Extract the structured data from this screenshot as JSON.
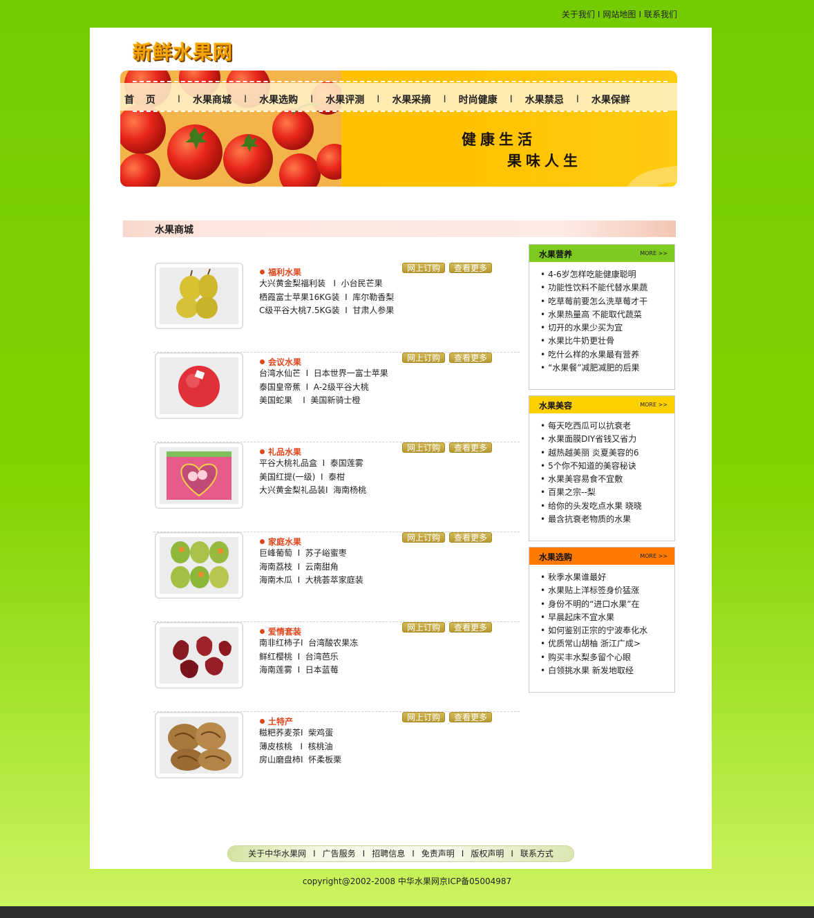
{
  "top_links": [
    "关于我们",
    "网站地图",
    "联系我们"
  ],
  "logo_text": "新鲜水果网",
  "nav": [
    "首 页",
    "水果商城",
    "水果选购",
    "水果评测",
    "水果采摘",
    "时尚健康",
    "水果禁忌",
    "水果保鲜"
  ],
  "slogan": {
    "line1": "健康生活",
    "line2": "果味人生"
  },
  "section_title": "水果商城",
  "buttons": {
    "order": "网上订购",
    "more": "查看更多"
  },
  "products": [
    {
      "category": "福利水果",
      "lines": [
        "大兴黄金梨福利装   I  小台民芒果",
        "栖霞富士苹果16KG装  I  库尔勒香梨",
        "C级平谷大桃7.5KG装  I  甘肃人参果"
      ]
    },
    {
      "category": "会议水果",
      "lines": [
        "台湾水仙芒  I  日本世界一富士苹果",
        "泰国皇帝蕉  I  A-2级平谷大桃",
        "美国蛇果    I  美国新骑士橙"
      ]
    },
    {
      "category": "礼品水果",
      "lines": [
        "平谷大桃礼品盒  I  泰国莲雾",
        "美国红提(一级)  I  泰柑",
        "大兴黄金梨礼品装I  海南杨桃"
      ]
    },
    {
      "category": "家庭水果",
      "lines": [
        "巨峰葡萄  I  苏子峪蜜枣",
        "海南荔枝  I  云南甜角",
        "海南木瓜  I  大桃荟萃家庭装"
      ]
    },
    {
      "category": "爱情套装",
      "lines": [
        "南非红柿子I  台湾酸农果冻",
        "鲜红樱桃  I  台湾芭乐",
        "海南莲雾  I  日本蓝莓"
      ]
    },
    {
      "category": "土特产",
      "lines": [
        "糍粑荞麦茶I  柴鸡蛋",
        "薄皮核桃   I  核桃油",
        "房山磨盘柿I  怀柔板栗"
      ]
    }
  ],
  "sidebar": [
    {
      "title": "水果营养",
      "more": "MORE >>",
      "color": "#7dcb1e",
      "items": [
        "4-6岁怎样吃能健康聪明",
        "功能性饮料不能代替水果蔬",
        "吃草莓前要怎么洗草莓才干",
        "水果热量高 不能取代蔬菜",
        "切开的水果少买为宜",
        "水果比牛奶更壮骨",
        "吃什么样的水果最有营养",
        "“水果餐”减肥减肥的后果"
      ]
    },
    {
      "title": "水果美容",
      "more": "MORE >>",
      "color": "#ffd000",
      "items": [
        "每天吃西瓜可以抗衰老",
        "水果面膜DIY省钱又省力",
        "越热越美丽 炎夏美容的6",
        "5个你不知道的美容秘诀",
        "水果美容易食不宜敷",
        "百果之宗--梨",
        "给你的头发吃点水果 晓晓",
        "最含抗衰老物质的水果"
      ]
    },
    {
      "title": "水果选购",
      "more": "MORE >>",
      "color": "#ff7a00",
      "items": [
        "秋季水果谁最好",
        "水果贴上洋标签身价猛涨",
        "身份不明的“进口水果”在",
        "早晨起床不宜水果",
        "如何鉴别正宗的宁波奉化水",
        "优质常山胡柚 浙江广成>",
        "购买丰水梨多留个心眼",
        "白领挑水果 新发地取经"
      ]
    }
  ],
  "footer_links": [
    "关于中华水果网",
    "广告服务",
    "招聘信息",
    "免责声明",
    "版权声明",
    "联系方式"
  ],
  "copyright": "copyright@2002-2008 中华水果网京ICP备05004987"
}
